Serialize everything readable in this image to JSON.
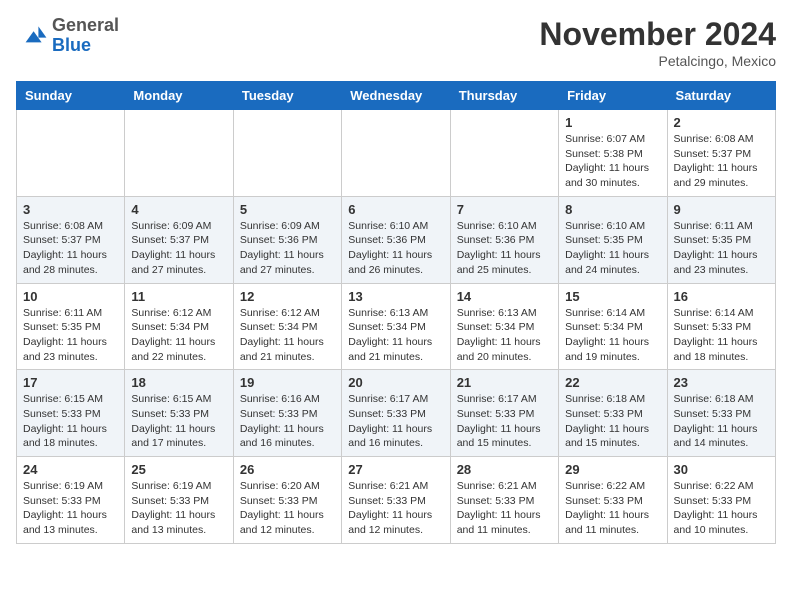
{
  "header": {
    "logo_general": "General",
    "logo_blue": "Blue",
    "month_title": "November 2024",
    "location": "Petalcingo, Mexico"
  },
  "days_of_week": [
    "Sunday",
    "Monday",
    "Tuesday",
    "Wednesday",
    "Thursday",
    "Friday",
    "Saturday"
  ],
  "weeks": [
    [
      {
        "day": "",
        "info": ""
      },
      {
        "day": "",
        "info": ""
      },
      {
        "day": "",
        "info": ""
      },
      {
        "day": "",
        "info": ""
      },
      {
        "day": "",
        "info": ""
      },
      {
        "day": "1",
        "info": "Sunrise: 6:07 AM\nSunset: 5:38 PM\nDaylight: 11 hours and 30 minutes."
      },
      {
        "day": "2",
        "info": "Sunrise: 6:08 AM\nSunset: 5:37 PM\nDaylight: 11 hours and 29 minutes."
      }
    ],
    [
      {
        "day": "3",
        "info": "Sunrise: 6:08 AM\nSunset: 5:37 PM\nDaylight: 11 hours and 28 minutes."
      },
      {
        "day": "4",
        "info": "Sunrise: 6:09 AM\nSunset: 5:37 PM\nDaylight: 11 hours and 27 minutes."
      },
      {
        "day": "5",
        "info": "Sunrise: 6:09 AM\nSunset: 5:36 PM\nDaylight: 11 hours and 27 minutes."
      },
      {
        "day": "6",
        "info": "Sunrise: 6:10 AM\nSunset: 5:36 PM\nDaylight: 11 hours and 26 minutes."
      },
      {
        "day": "7",
        "info": "Sunrise: 6:10 AM\nSunset: 5:36 PM\nDaylight: 11 hours and 25 minutes."
      },
      {
        "day": "8",
        "info": "Sunrise: 6:10 AM\nSunset: 5:35 PM\nDaylight: 11 hours and 24 minutes."
      },
      {
        "day": "9",
        "info": "Sunrise: 6:11 AM\nSunset: 5:35 PM\nDaylight: 11 hours and 23 minutes."
      }
    ],
    [
      {
        "day": "10",
        "info": "Sunrise: 6:11 AM\nSunset: 5:35 PM\nDaylight: 11 hours and 23 minutes."
      },
      {
        "day": "11",
        "info": "Sunrise: 6:12 AM\nSunset: 5:34 PM\nDaylight: 11 hours and 22 minutes."
      },
      {
        "day": "12",
        "info": "Sunrise: 6:12 AM\nSunset: 5:34 PM\nDaylight: 11 hours and 21 minutes."
      },
      {
        "day": "13",
        "info": "Sunrise: 6:13 AM\nSunset: 5:34 PM\nDaylight: 11 hours and 21 minutes."
      },
      {
        "day": "14",
        "info": "Sunrise: 6:13 AM\nSunset: 5:34 PM\nDaylight: 11 hours and 20 minutes."
      },
      {
        "day": "15",
        "info": "Sunrise: 6:14 AM\nSunset: 5:34 PM\nDaylight: 11 hours and 19 minutes."
      },
      {
        "day": "16",
        "info": "Sunrise: 6:14 AM\nSunset: 5:33 PM\nDaylight: 11 hours and 18 minutes."
      }
    ],
    [
      {
        "day": "17",
        "info": "Sunrise: 6:15 AM\nSunset: 5:33 PM\nDaylight: 11 hours and 18 minutes."
      },
      {
        "day": "18",
        "info": "Sunrise: 6:15 AM\nSunset: 5:33 PM\nDaylight: 11 hours and 17 minutes."
      },
      {
        "day": "19",
        "info": "Sunrise: 6:16 AM\nSunset: 5:33 PM\nDaylight: 11 hours and 16 minutes."
      },
      {
        "day": "20",
        "info": "Sunrise: 6:17 AM\nSunset: 5:33 PM\nDaylight: 11 hours and 16 minutes."
      },
      {
        "day": "21",
        "info": "Sunrise: 6:17 AM\nSunset: 5:33 PM\nDaylight: 11 hours and 15 minutes."
      },
      {
        "day": "22",
        "info": "Sunrise: 6:18 AM\nSunset: 5:33 PM\nDaylight: 11 hours and 15 minutes."
      },
      {
        "day": "23",
        "info": "Sunrise: 6:18 AM\nSunset: 5:33 PM\nDaylight: 11 hours and 14 minutes."
      }
    ],
    [
      {
        "day": "24",
        "info": "Sunrise: 6:19 AM\nSunset: 5:33 PM\nDaylight: 11 hours and 13 minutes."
      },
      {
        "day": "25",
        "info": "Sunrise: 6:19 AM\nSunset: 5:33 PM\nDaylight: 11 hours and 13 minutes."
      },
      {
        "day": "26",
        "info": "Sunrise: 6:20 AM\nSunset: 5:33 PM\nDaylight: 11 hours and 12 minutes."
      },
      {
        "day": "27",
        "info": "Sunrise: 6:21 AM\nSunset: 5:33 PM\nDaylight: 11 hours and 12 minutes."
      },
      {
        "day": "28",
        "info": "Sunrise: 6:21 AM\nSunset: 5:33 PM\nDaylight: 11 hours and 11 minutes."
      },
      {
        "day": "29",
        "info": "Sunrise: 6:22 AM\nSunset: 5:33 PM\nDaylight: 11 hours and 11 minutes."
      },
      {
        "day": "30",
        "info": "Sunrise: 6:22 AM\nSunset: 5:33 PM\nDaylight: 11 hours and 10 minutes."
      }
    ]
  ]
}
